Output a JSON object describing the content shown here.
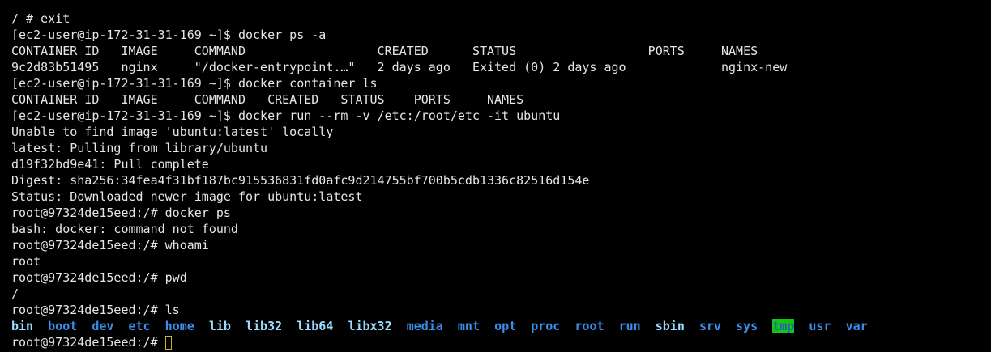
{
  "terminal": {
    "lines": [
      "/ # exit",
      "[ec2-user@ip-172-31-31-169 ~]$ docker ps -a",
      "CONTAINER ID   IMAGE     COMMAND                  CREATED      STATUS                  PORTS     NAMES",
      "9c2d83b51495   nginx     \"/docker-entrypoint.…\"   2 days ago   Exited (0) 2 days ago             nginx-new",
      "[ec2-user@ip-172-31-31-169 ~]$ docker container ls",
      "CONTAINER ID   IMAGE     COMMAND   CREATED   STATUS    PORTS     NAMES",
      "[ec2-user@ip-172-31-31-169 ~]$ docker run --rm -v /etc:/root/etc -it ubuntu",
      "Unable to find image 'ubuntu:latest' locally",
      "latest: Pulling from library/ubuntu",
      "d19f32bd9e41: Pull complete",
      "Digest: sha256:34fea4f31bf187bc915536831fd0afc9d214755bf700b5cdb1336c82516d154e",
      "Status: Downloaded newer image for ubuntu:latest",
      "root@97324de15eed:/# docker ps",
      "bash: docker: command not found",
      "root@97324de15eed:/# whoami",
      "root",
      "root@97324de15eed:/# pwd",
      "/",
      "root@97324de15eed:/# ls"
    ],
    "ls_entries": [
      {
        "name": "bin",
        "kind": "cyan"
      },
      {
        "name": "boot",
        "kind": "blue"
      },
      {
        "name": "dev",
        "kind": "blue"
      },
      {
        "name": "etc",
        "kind": "blue"
      },
      {
        "name": "home",
        "kind": "blue"
      },
      {
        "name": "lib",
        "kind": "cyan"
      },
      {
        "name": "lib32",
        "kind": "cyan"
      },
      {
        "name": "lib64",
        "kind": "cyan"
      },
      {
        "name": "libx32",
        "kind": "cyan"
      },
      {
        "name": "media",
        "kind": "blue"
      },
      {
        "name": "mnt",
        "kind": "blue"
      },
      {
        "name": "opt",
        "kind": "blue"
      },
      {
        "name": "proc",
        "kind": "blue"
      },
      {
        "name": "root",
        "kind": "blue"
      },
      {
        "name": "run",
        "kind": "blue"
      },
      {
        "name": "sbin",
        "kind": "cyan"
      },
      {
        "name": "srv",
        "kind": "blue"
      },
      {
        "name": "sys",
        "kind": "blue"
      },
      {
        "name": "tmp",
        "kind": "tmp"
      },
      {
        "name": "usr",
        "kind": "blue"
      },
      {
        "name": "var",
        "kind": "blue"
      }
    ],
    "prompt": "root@97324de15eed:/# ",
    "colors": {
      "background": "#000000",
      "text": "#e6e6e6",
      "dir_blue": "#3b8eea",
      "dir_cyan": "#9cdcfe",
      "tmp_bg": "#16c60c",
      "cursor_border": "#c9b030"
    }
  }
}
